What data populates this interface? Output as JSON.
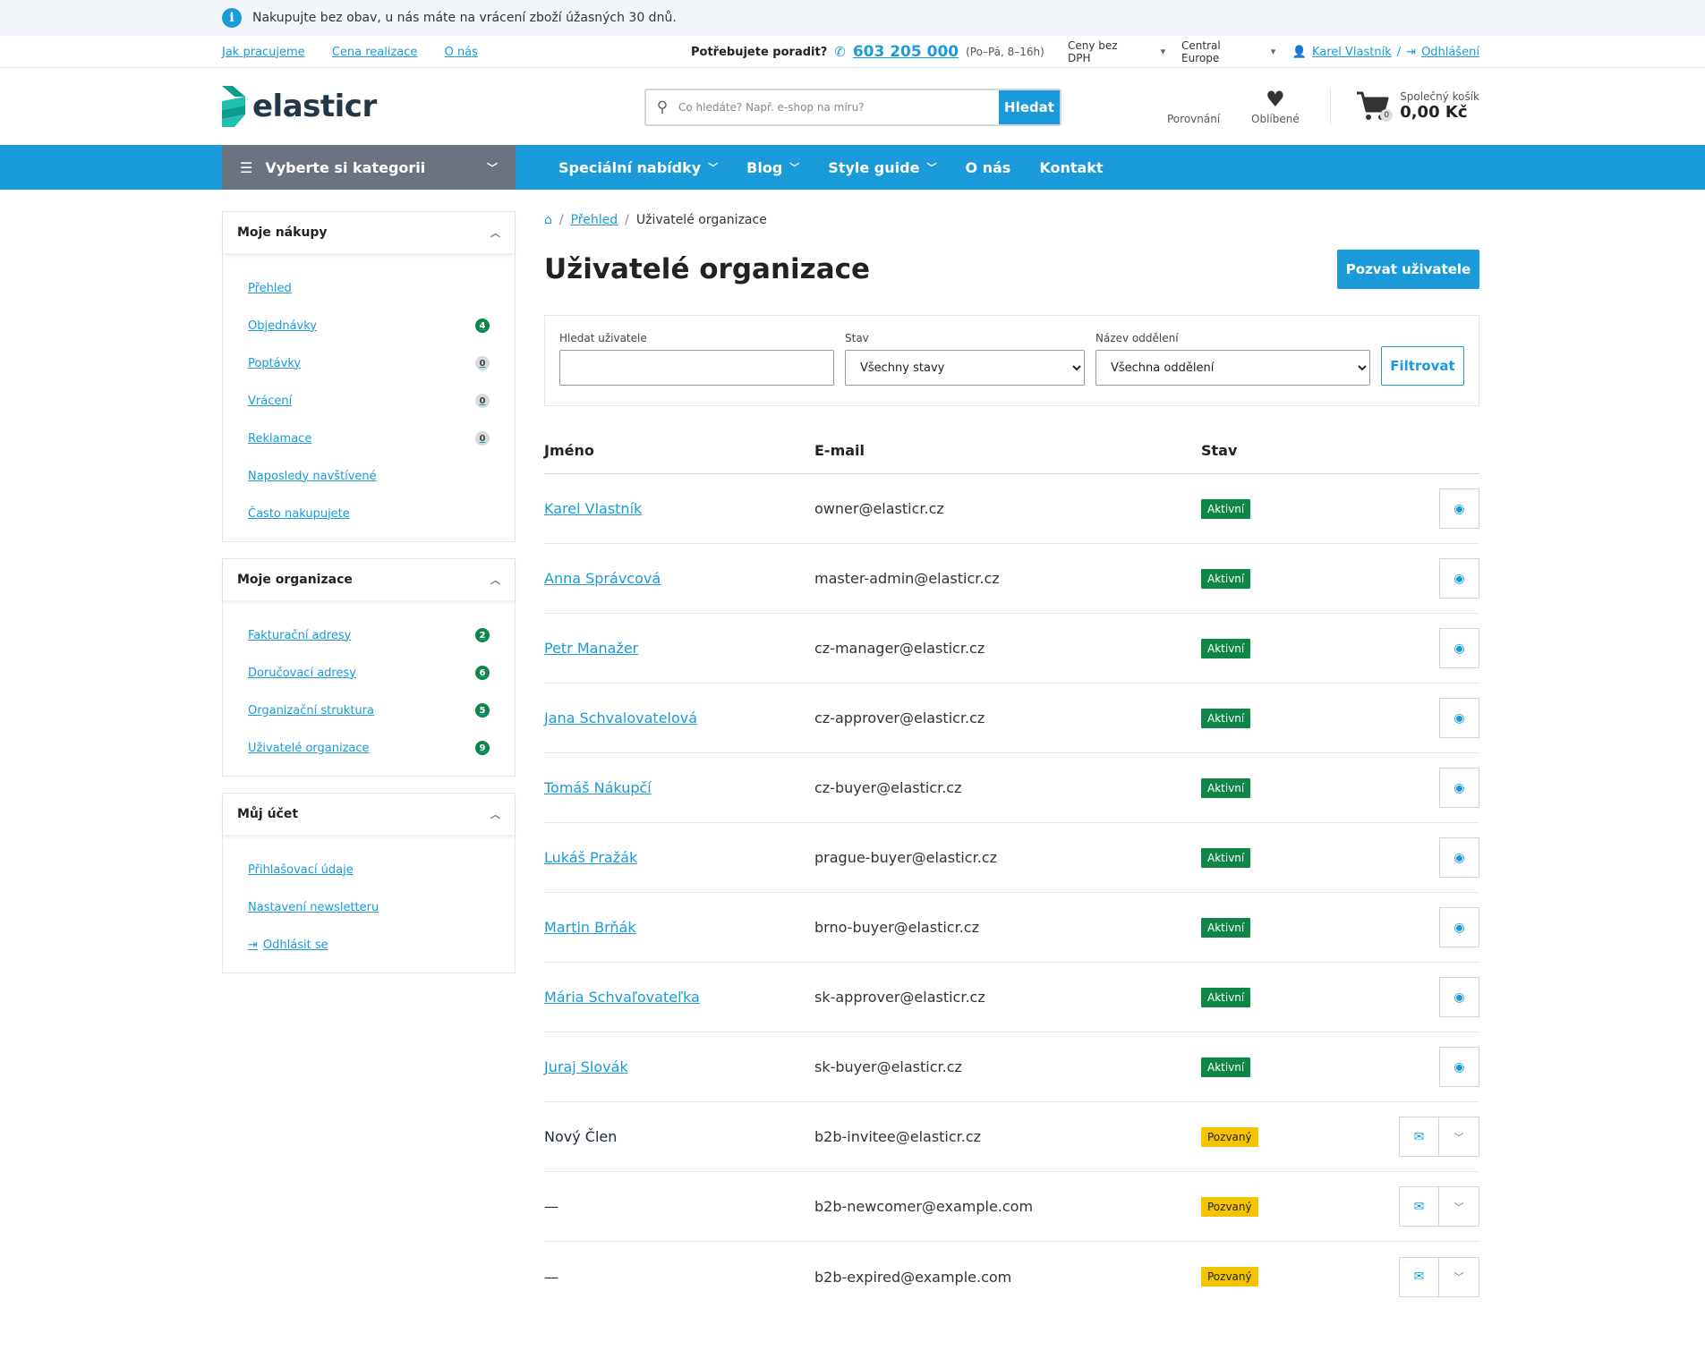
{
  "notice": {
    "text": "Nakupujte bez obav, u nás máte na vrácení zboží úžasných 30 dnů."
  },
  "topbar": {
    "links": [
      "Jak pracujeme",
      "Cena realizace",
      "O nás"
    ],
    "advice_label": "Potřebujete poradit?",
    "phone": "603 205 000",
    "hours": "(Po–Pá, 8–16h)",
    "price_line1": "Ceny bez",
    "price_line2": "DPH",
    "region_line1": "Central",
    "region_line2": "Europe",
    "user_name": "Karel Vlastník",
    "logout": "Odhlášení"
  },
  "header": {
    "logo_text": "elasticr",
    "search_placeholder": "Co hledáte? Např. e-shop na míru?",
    "search_button": "Hledat",
    "compare": "Porovnání",
    "favorites": "Oblíbené",
    "cart_label": "Společný košík",
    "cart_total": "0,00 Kč",
    "cart_count": "0"
  },
  "nav": {
    "category": "Vyberte si kategorii",
    "items": [
      "Speciální nabídky",
      "Blog",
      "Style guide",
      "O nás",
      "Kontakt"
    ]
  },
  "sidebar": {
    "purchases": {
      "title": "Moje nákupy",
      "items": [
        {
          "label": "Přehled",
          "badge": ""
        },
        {
          "label": "Objednávky",
          "badge": "4"
        },
        {
          "label": "Poptávky",
          "badge": "0"
        },
        {
          "label": "Vrácení",
          "badge": "0"
        },
        {
          "label": "Reklamace",
          "badge": "0"
        },
        {
          "label": "Naposledy navštívené",
          "badge": ""
        },
        {
          "label": "Často nakupujete",
          "badge": ""
        }
      ]
    },
    "organization": {
      "title": "Moje organizace",
      "items": [
        {
          "label": "Fakturační adresy",
          "badge": "2"
        },
        {
          "label": "Doručovací adresy",
          "badge": "6"
        },
        {
          "label": "Organizační struktura",
          "badge": "5"
        },
        {
          "label": "Uživatelé organizace",
          "badge": "9"
        }
      ]
    },
    "account": {
      "title": "Můj účet",
      "items": [
        {
          "label": "Přihlašovací údaje"
        },
        {
          "label": "Nastavení newsletteru"
        },
        {
          "label": "Odhlásit se"
        }
      ]
    }
  },
  "breadcrumb": {
    "parent": "Přehled",
    "current": "Uživatelé organizace"
  },
  "page": {
    "title": "Uživatelé organizace",
    "invite_button": "Pozvat uživatele"
  },
  "filter": {
    "search_label": "Hledat uživatele",
    "search_value": "",
    "state_label": "Stav",
    "state_value": "Všechny stavy",
    "dept_label": "Název oddělení",
    "dept_value": "Všechna oddělení",
    "button": "Filtrovat"
  },
  "table": {
    "headers": {
      "name": "Jméno",
      "email": "E-mail",
      "state": "Stav"
    },
    "rows": [
      {
        "name": "Karel Vlastník",
        "email": "owner@elasticr.cz",
        "state": "Aktivní"
      },
      {
        "name": "Anna Správcová",
        "email": "master-admin@elasticr.cz",
        "state": "Aktivní"
      },
      {
        "name": "Petr Manažer",
        "email": "cz-manager@elasticr.cz",
        "state": "Aktivní"
      },
      {
        "name": "Jana Schvalovatelová",
        "email": "cz-approver@elasticr.cz",
        "state": "Aktivní"
      },
      {
        "name": "Tomáš Nákupčí",
        "email": "cz-buyer@elasticr.cz",
        "state": "Aktivní"
      },
      {
        "name": "Lukáš Pražák",
        "email": "prague-buyer@elasticr.cz",
        "state": "Aktivní"
      },
      {
        "name": "Martin Brňák",
        "email": "brno-buyer@elasticr.cz",
        "state": "Aktivní"
      },
      {
        "name": "Mária Schvaľovateľka",
        "email": "sk-approver@elasticr.cz",
        "state": "Aktivní"
      },
      {
        "name": "Juraj Slovák",
        "email": "sk-buyer@elasticr.cz",
        "state": "Aktivní"
      },
      {
        "name": "Nový Člen",
        "email": "b2b-invitee@elasticr.cz",
        "state": "Pozvaný"
      },
      {
        "name": "—",
        "email": "b2b-newcomer@example.com",
        "state": "Pozvaný"
      },
      {
        "name": "—",
        "email": "b2b-expired@example.com",
        "state": "Pozvaný"
      }
    ]
  },
  "colors": {
    "accent": "#1a9ad8",
    "active": "#108548",
    "invited": "#f5c400",
    "nav_dark": "#6b7280"
  }
}
